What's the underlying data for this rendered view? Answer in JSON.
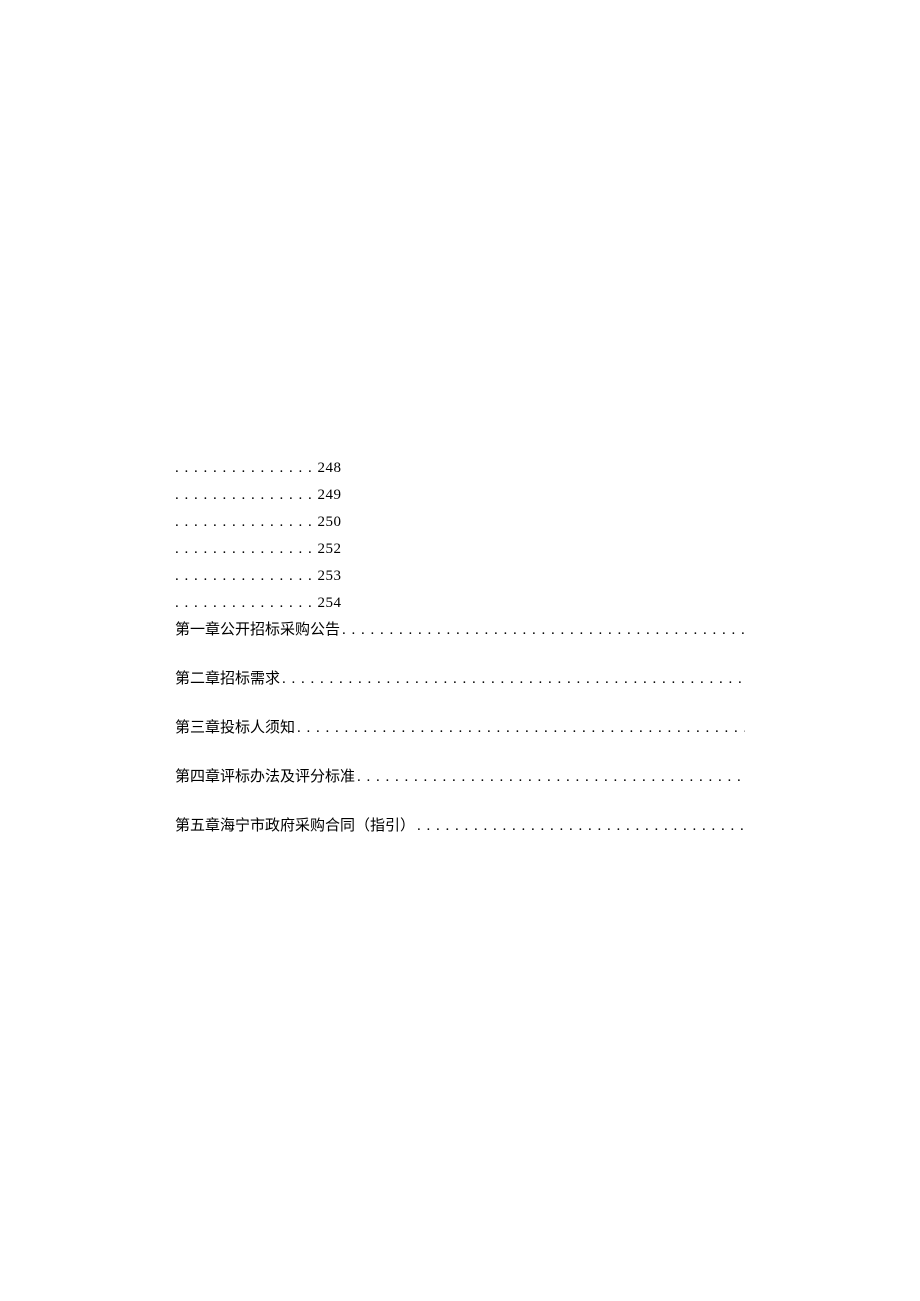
{
  "page_refs": [
    {
      "dots": ". . . . . . . . . . . . . . . ",
      "number": "248"
    },
    {
      "dots": ". . . . . . . . . . . . . . . ",
      "number": "249"
    },
    {
      "dots": ". . . . . . . . . . . . . . . ",
      "number": "250"
    },
    {
      "dots": ". . . . . . . . . . . . . . . ",
      "number": "252"
    },
    {
      "dots": ". . . . . . . . . . . . . . . ",
      "number": "253"
    },
    {
      "dots": ". . . . . . . . . . . . . . . ",
      "number": "254"
    }
  ],
  "toc_entries": [
    {
      "title": "第一章公开招标采购公告"
    },
    {
      "title": "第二章招标需求"
    },
    {
      "title": "第三章投标人须知"
    },
    {
      "title": "第四章评标办法及评分标准"
    },
    {
      "title": "第五章海宁市政府采购合同（指引）"
    }
  ],
  "leader_dots": " . . . . . . . . . . . . . . . . . . . . . . . . . . . . . . . . . . . . . . . . . . . . . . . . . . . . . . . . . . . . . . . . . . . . . . . . . . . . . . . ."
}
